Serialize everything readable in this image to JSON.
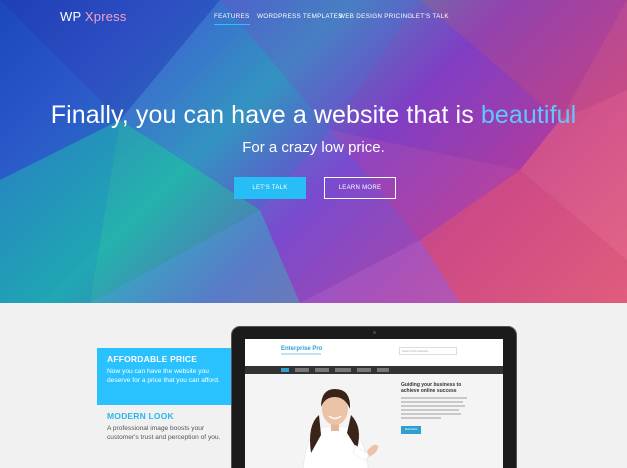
{
  "brand": {
    "part1": "WP",
    "part2": "Xpress"
  },
  "nav": {
    "items": [
      {
        "label": "FEATURES",
        "active": true
      },
      {
        "label": "WORDPRESS TEMPLATES",
        "active": false
      },
      {
        "label": "WEB DESIGN PRICING",
        "active": false
      },
      {
        "label": "LET'S TALK",
        "active": false
      }
    ]
  },
  "hero": {
    "headline_main": "Finally, you can have a website that is ",
    "headline_highlight": "beautiful",
    "subheadline": "For a crazy low price.",
    "primary_button": "LET'S TALK",
    "secondary_button": "LEARN MORE"
  },
  "features": {
    "items": [
      {
        "title": "AFFORDABLE PRICE",
        "text": "Now you can have the website you deserve for a price that you can afford."
      },
      {
        "title": "MODERN LOOK",
        "text": "A professional image boosts your customer's trust and perception of you."
      }
    ]
  },
  "mockup": {
    "logo": "Enterprise Pro",
    "search_placeholder": "Search this website...",
    "cta_title": "Guiding your business to achieve online success",
    "cta_button": "Read More"
  },
  "colors": {
    "accent": "#29c2ff",
    "headline_highlight": "#5fc8ff",
    "section_bg": "#f1f1f1"
  }
}
